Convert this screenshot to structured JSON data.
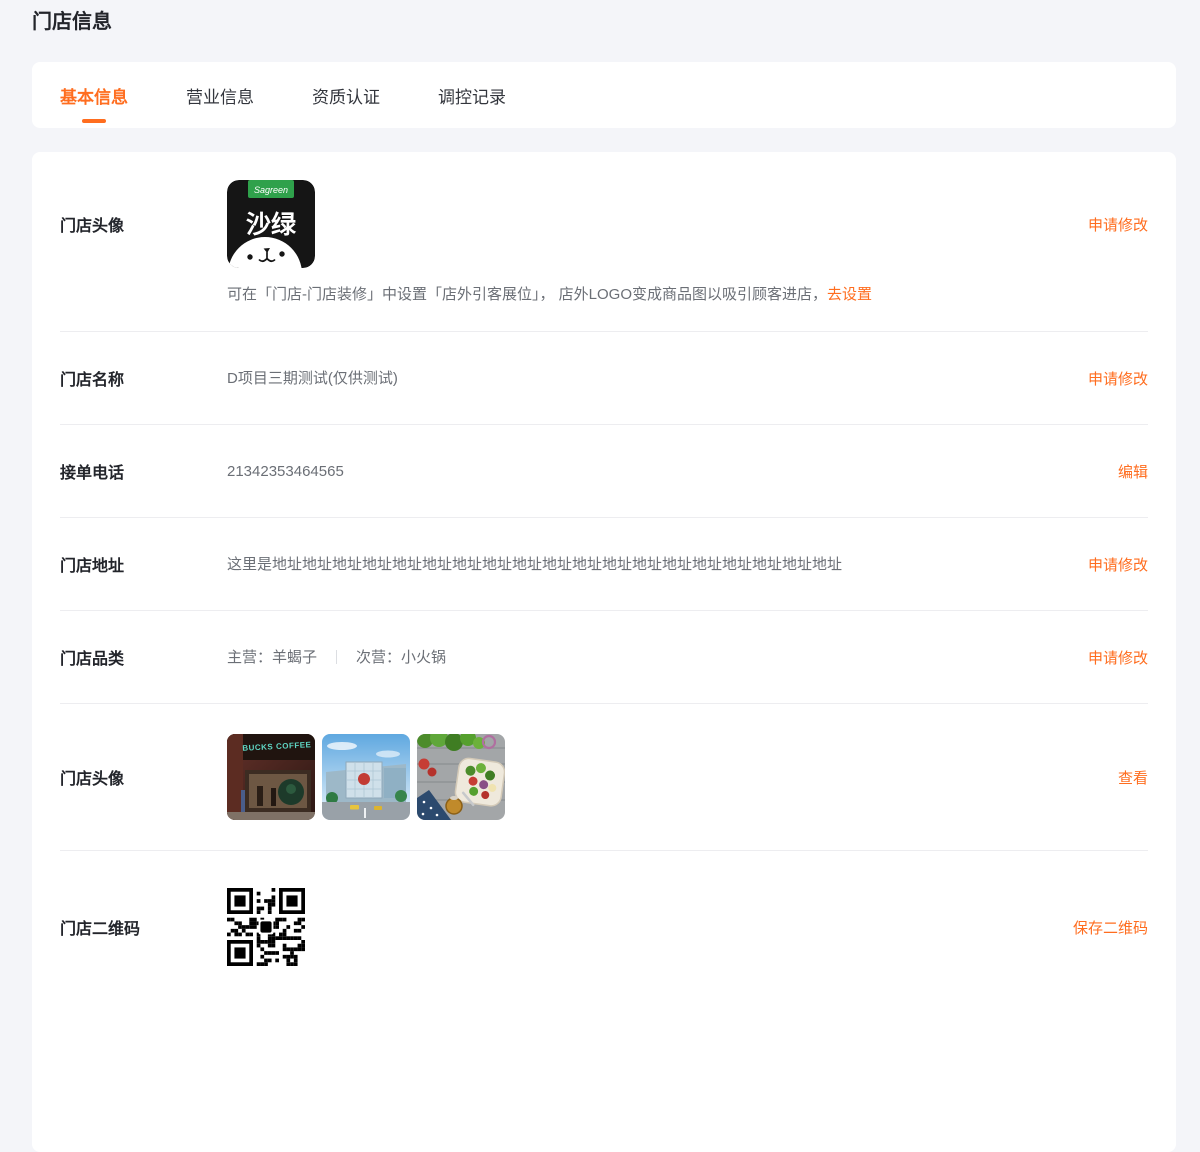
{
  "colors": {
    "accent": "#ff6d1f",
    "page_bg": "#f4f5f9",
    "card_bg": "#ffffff",
    "divider": "#ededf0",
    "logo_green": "#2fa14b"
  },
  "page": {
    "title": "门店信息"
  },
  "tabs": {
    "items": [
      {
        "label": "基本信息",
        "active": true
      },
      {
        "label": "营业信息",
        "active": false
      },
      {
        "label": "资质认证",
        "active": false
      },
      {
        "label": "调控记录",
        "active": false
      }
    ]
  },
  "rows": {
    "avatar": {
      "label": "门店头像",
      "action": "申请修改",
      "logo_icon": "sagreen-bear-logo",
      "logo_brand": "Sagreen",
      "logo_name": "沙绿",
      "hint": "可在「门店-门店装修」中设置「店外引客展位」， 店外LOGO变成商品图以吸引顾客进店，",
      "hint_link": "去设置"
    },
    "name": {
      "label": "门店名称",
      "value": "D项目三期测试(仅供测试)",
      "action": "申请修改"
    },
    "phone": {
      "label": "接单电话",
      "value": "21342353464565",
      "action": "编辑"
    },
    "address": {
      "label": "门店地址",
      "value": "这里是地址地址地址地址地址地址地址地址地址地址地址地址地址地址地址地址地址地址地址",
      "action": "申请修改"
    },
    "category": {
      "label": "门店品类",
      "primary": "主营：羊蝎子",
      "secondary": "次营：小火锅",
      "action": "申请修改"
    },
    "photos": {
      "label": "门店头像",
      "action": "查看",
      "items": [
        "storefront-photo",
        "mall-photo",
        "salad-photo"
      ]
    },
    "qrcode": {
      "label": "门店二维码",
      "action": "保存二维码",
      "icon": "qr-code"
    }
  }
}
